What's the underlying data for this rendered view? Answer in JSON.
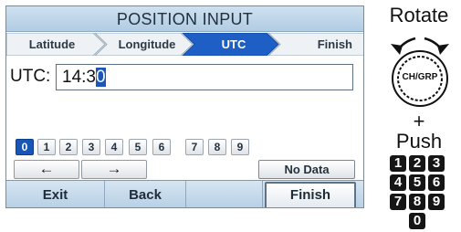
{
  "screen": {
    "title": "POSITION INPUT",
    "steps": [
      {
        "label": "Latitude",
        "active": false
      },
      {
        "label": "Longitude",
        "active": false
      },
      {
        "label": "UTC",
        "active": true
      },
      {
        "label": "Finish",
        "active": false
      }
    ],
    "field": {
      "label": "UTC:",
      "value_before_cursor": "14:3",
      "value_cursor_char": "0"
    },
    "keypad": {
      "keys": [
        "0",
        "1",
        "2",
        "3",
        "4",
        "5",
        "6",
        "7",
        "8",
        "9"
      ],
      "selected": "0"
    },
    "arrows": {
      "left": "←",
      "right": "→"
    },
    "no_data_label": "No Data",
    "softkeys": {
      "exit": "Exit",
      "back": "Back",
      "finish": "Finish"
    }
  },
  "side_panel": {
    "rotate_label": "Rotate",
    "knob_label": "CH/GRP",
    "plus_label": "+",
    "push_label": "Push",
    "number_keys": [
      "1",
      "2",
      "3",
      "4",
      "5",
      "6",
      "7",
      "8",
      "9",
      "0"
    ]
  },
  "colors": {
    "title_bar": "#c4d9ec",
    "active_step": "#1d5fc4",
    "cursor_highlight": "#1c56b8",
    "selected_key": "#1856b5"
  }
}
